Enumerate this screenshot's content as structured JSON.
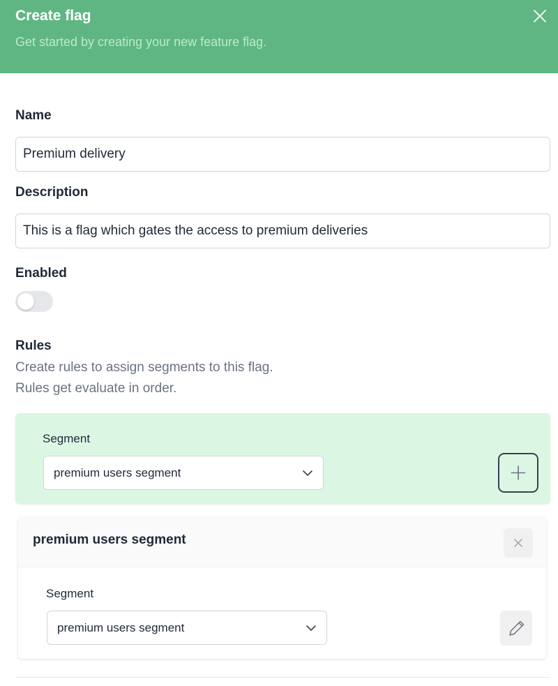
{
  "header": {
    "title": "Create flag",
    "subtitle": "Get started by creating your new feature flag.",
    "close_icon": "close-icon",
    "background_color": "#60b683"
  },
  "form": {
    "name_label": "Name",
    "name_value": "Premium delivery",
    "description_label": "Description",
    "description_value": "This is a flag which gates the access to premium deliveries",
    "enabled_label": "Enabled",
    "enabled": false
  },
  "rules": {
    "heading": "Rules",
    "help_line1": "Create rules to assign segments to this flag.",
    "help_line2": "Rules get evaluate in order.",
    "new_rule": {
      "segment_label": "Segment",
      "segment_value": "premium users segment",
      "add_icon": "plus-icon",
      "panel_color": "#dcf6e4"
    },
    "items": [
      {
        "title": "premium users segment",
        "segment_label": "Segment",
        "segment_value": "premium users segment",
        "remove_icon": "close-icon",
        "edit_icon": "pencil-icon"
      }
    ]
  }
}
